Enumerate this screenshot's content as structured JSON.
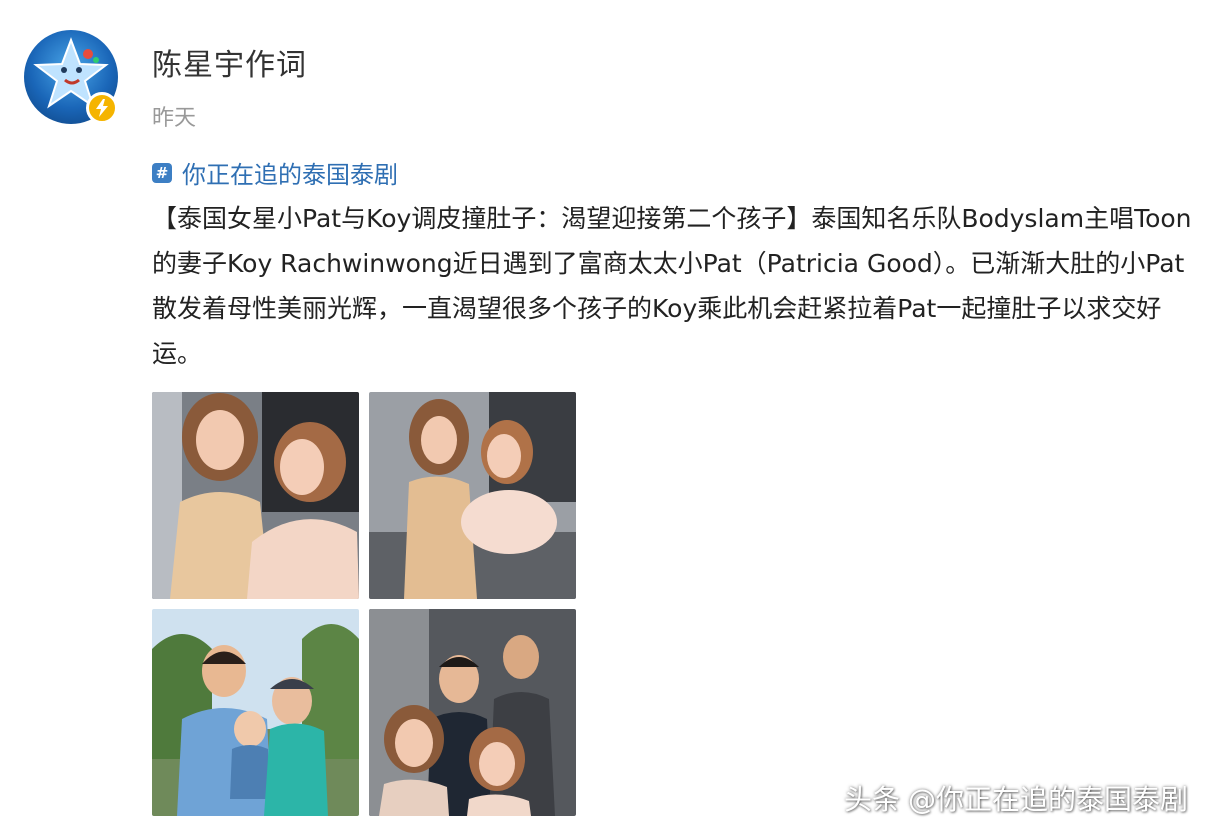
{
  "author": {
    "name": "陈星宇作词",
    "time": "昨天",
    "avatar_icon": "star-mascot-icon",
    "badge_icon": "lightning-icon",
    "badge_color": "#f5b400"
  },
  "topic": {
    "icon": "hashtag-icon",
    "label": "你正在追的泰国泰剧",
    "color": "#2f6fb3"
  },
  "post": {
    "text": "【泰国女星小Pat与Koy调皮撞肚子：渴望迎接第二个孩子】泰国知名乐队Bodyslam主唱Toon的妻子Koy Rachwinwong近日遇到了富商太太小Pat（Patricia Good）。已渐渐大肚的小Pat散发着母性美丽光辉，一直渴望很多个孩子的Koy乘此机会赶紧拉着Pat一起撞肚子以求交好运。"
  },
  "photos": [
    {
      "name": "photo-two-women-portrait"
    },
    {
      "name": "photo-two-women-belly"
    },
    {
      "name": "photo-family-with-child"
    },
    {
      "name": "photo-group-selfie"
    }
  ],
  "watermark": {
    "platform": "头条",
    "handle": "@你正在追的泰国泰剧"
  }
}
